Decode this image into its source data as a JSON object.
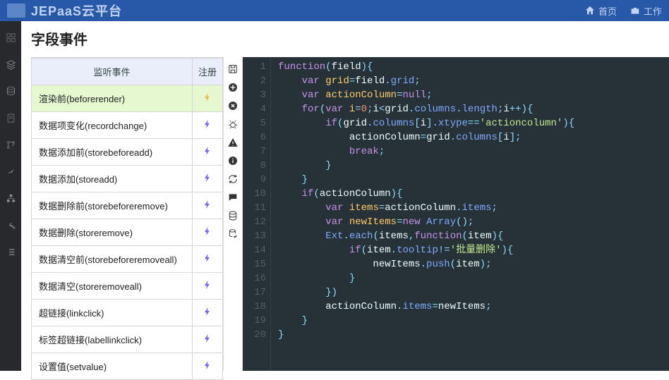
{
  "topbar": {
    "brand": "JEPaaS云平台",
    "home_label": "首页",
    "work_label": "工作"
  },
  "page": {
    "title": "字段事件"
  },
  "table": {
    "col_event": "监听事件",
    "col_reg": "注册",
    "rows": [
      {
        "label": "渲染前(beforerender)",
        "registered": true,
        "selected": true
      },
      {
        "label": "数据项变化(recordchange)",
        "registered": false,
        "selected": false
      },
      {
        "label": "数据添加前(storebeforeadd)",
        "registered": false,
        "selected": false
      },
      {
        "label": "数据添加(storeadd)",
        "registered": false,
        "selected": false
      },
      {
        "label": "数据删除前(storebeforeremove)",
        "registered": false,
        "selected": false
      },
      {
        "label": "数据删除(storeremove)",
        "registered": false,
        "selected": false
      },
      {
        "label": "数据清空前(storebeforeremoveall)",
        "registered": false,
        "selected": false
      },
      {
        "label": "数据清空(storeremoveall)",
        "registered": false,
        "selected": false
      },
      {
        "label": "超链接(linkclick)",
        "registered": false,
        "selected": false
      },
      {
        "label": "标签超链接(labellinkclick)",
        "registered": false,
        "selected": false
      },
      {
        "label": "设置值(setvalue)",
        "registered": false,
        "selected": false
      }
    ]
  },
  "code_lines": 20,
  "code_tokens": [
    [
      [
        "kw",
        "function"
      ],
      [
        "pun",
        "("
      ],
      [
        "id",
        "field"
      ],
      [
        "pun",
        "){"
      ]
    ],
    [
      [
        "pun",
        "    "
      ],
      [
        "kw",
        "var"
      ],
      [
        "pun",
        " "
      ],
      [
        "decl",
        "grid"
      ],
      [
        "pun",
        "="
      ],
      [
        "id",
        "field"
      ],
      [
        "pun",
        "."
      ],
      [
        "prop",
        "grid"
      ],
      [
        "pun",
        ";"
      ]
    ],
    [
      [
        "pun",
        "    "
      ],
      [
        "kw",
        "var"
      ],
      [
        "pun",
        " "
      ],
      [
        "decl",
        "actionColumn"
      ],
      [
        "pun",
        "="
      ],
      [
        "kw",
        "null"
      ],
      [
        "pun",
        ";"
      ]
    ],
    [
      [
        "pun",
        "    "
      ],
      [
        "kw",
        "for"
      ],
      [
        "pun",
        "("
      ],
      [
        "kw",
        "var"
      ],
      [
        "pun",
        " "
      ],
      [
        "decl",
        "i"
      ],
      [
        "pun",
        "="
      ],
      [
        "num",
        "0"
      ],
      [
        "pun",
        ";"
      ],
      [
        "id",
        "i"
      ],
      [
        "pun",
        "<"
      ],
      [
        "id",
        "grid"
      ],
      [
        "pun",
        "."
      ],
      [
        "prop",
        "columns"
      ],
      [
        "pun",
        "."
      ],
      [
        "prop",
        "length"
      ],
      [
        "pun",
        ";"
      ],
      [
        "id",
        "i"
      ],
      [
        "pun",
        "++){"
      ]
    ],
    [
      [
        "pun",
        "        "
      ],
      [
        "kw",
        "if"
      ],
      [
        "pun",
        "("
      ],
      [
        "id",
        "grid"
      ],
      [
        "pun",
        "."
      ],
      [
        "prop",
        "columns"
      ],
      [
        "pun",
        "["
      ],
      [
        "id",
        "i"
      ],
      [
        "pun",
        "]."
      ],
      [
        "prop",
        "xtype"
      ],
      [
        "pun",
        "=="
      ],
      [
        "str",
        "'actioncolumn'"
      ],
      [
        "pun",
        "){"
      ]
    ],
    [
      [
        "pun",
        "            "
      ],
      [
        "id",
        "actionColumn"
      ],
      [
        "pun",
        "="
      ],
      [
        "id",
        "grid"
      ],
      [
        "pun",
        "."
      ],
      [
        "prop",
        "columns"
      ],
      [
        "pun",
        "["
      ],
      [
        "id",
        "i"
      ],
      [
        "pun",
        "];"
      ]
    ],
    [
      [
        "pun",
        "            "
      ],
      [
        "kw",
        "break"
      ],
      [
        "pun",
        ";"
      ]
    ],
    [
      [
        "pun",
        "        }"
      ]
    ],
    [
      [
        "pun",
        "    }"
      ]
    ],
    [
      [
        "pun",
        "    "
      ],
      [
        "kw",
        "if"
      ],
      [
        "pun",
        "("
      ],
      [
        "id",
        "actionColumn"
      ],
      [
        "pun",
        "){"
      ]
    ],
    [
      [
        "pun",
        "        "
      ],
      [
        "kw",
        "var"
      ],
      [
        "pun",
        " "
      ],
      [
        "decl",
        "items"
      ],
      [
        "pun",
        "="
      ],
      [
        "id",
        "actionColumn"
      ],
      [
        "pun",
        "."
      ],
      [
        "prop",
        "items"
      ],
      [
        "pun",
        ";"
      ]
    ],
    [
      [
        "pun",
        "        "
      ],
      [
        "kw",
        "var"
      ],
      [
        "pun",
        " "
      ],
      [
        "decl",
        "newItems"
      ],
      [
        "pun",
        "="
      ],
      [
        "kw",
        "new"
      ],
      [
        "pun",
        " "
      ],
      [
        "prop",
        "Array"
      ],
      [
        "pun",
        "();"
      ]
    ],
    [
      [
        "pun",
        "        "
      ],
      [
        "prop",
        "Ext"
      ],
      [
        "pun",
        "."
      ],
      [
        "prop",
        "each"
      ],
      [
        "pun",
        "("
      ],
      [
        "id",
        "items"
      ],
      [
        "pun",
        ","
      ],
      [
        "kw",
        "function"
      ],
      [
        "pun",
        "("
      ],
      [
        "id",
        "item"
      ],
      [
        "pun",
        "){"
      ]
    ],
    [
      [
        "pun",
        "            "
      ],
      [
        "kw",
        "if"
      ],
      [
        "pun",
        "("
      ],
      [
        "id",
        "item"
      ],
      [
        "pun",
        "."
      ],
      [
        "prop",
        "tooltip"
      ],
      [
        "pun",
        "!="
      ],
      [
        "str",
        "'批量删除'"
      ],
      [
        "pun",
        "){"
      ]
    ],
    [
      [
        "pun",
        "                "
      ],
      [
        "id",
        "newItems"
      ],
      [
        "pun",
        "."
      ],
      [
        "prop",
        "push"
      ],
      [
        "pun",
        "("
      ],
      [
        "id",
        "item"
      ],
      [
        "pun",
        ");"
      ]
    ],
    [
      [
        "pun",
        "            }"
      ]
    ],
    [
      [
        "pun",
        "        })"
      ]
    ],
    [
      [
        "pun",
        "        "
      ],
      [
        "id",
        "actionColumn"
      ],
      [
        "pun",
        "."
      ],
      [
        "prop",
        "items"
      ],
      [
        "pun",
        "="
      ],
      [
        "id",
        "newItems"
      ],
      [
        "pun",
        ";"
      ]
    ],
    [
      [
        "pun",
        "    }"
      ]
    ],
    [
      [
        "pun",
        "}"
      ]
    ]
  ]
}
